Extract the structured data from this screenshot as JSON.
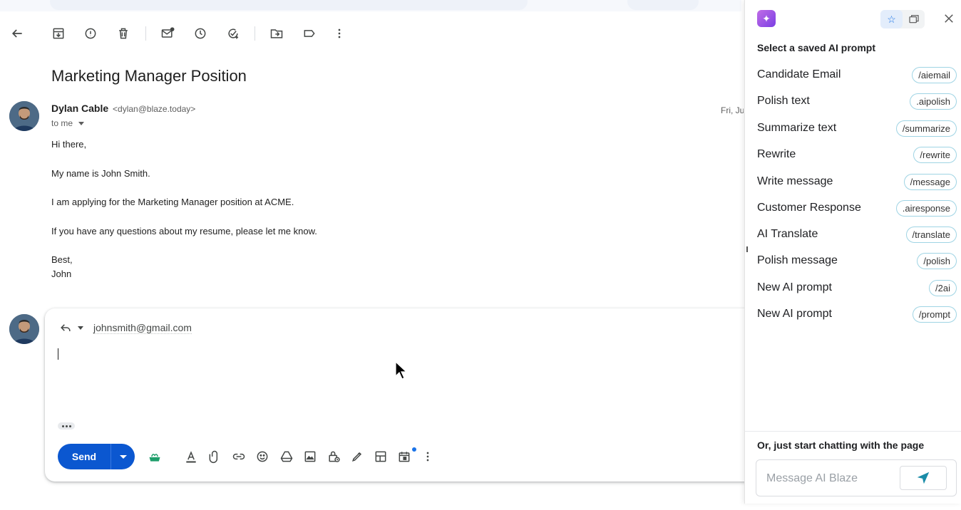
{
  "email": {
    "subject": "Marketing Manager Position",
    "sender_name": "Dylan Cable",
    "sender_email": "<dylan@blaze.today>",
    "to_label": "to me",
    "date": "Fri, Ju",
    "body": {
      "greeting": "Hi there,",
      "line1": "My name is John Smith.",
      "line2": "I am applying for the Marketing Manager position at ACME.",
      "line3": "If you have any questions about my resume, please let me know.",
      "signoff": "Best,",
      "signature": "John"
    }
  },
  "toolbar": {
    "icons": [
      "back-arrow-icon",
      "archive-icon",
      "report-spam-icon",
      "delete-icon",
      "mark-unread-icon",
      "snooze-icon",
      "add-task-icon",
      "move-to-icon",
      "label-icon",
      "more-vert-icon"
    ]
  },
  "reply": {
    "to": "johnsmith@gmail.com",
    "send_label": "Send"
  },
  "panel": {
    "heading": "Select a saved AI prompt",
    "prompts": [
      {
        "name": "Candidate Email",
        "shortcut": "/aiemail"
      },
      {
        "name": "Polish text",
        "shortcut": ".aipolish"
      },
      {
        "name": "Summarize text",
        "shortcut": "/summarize"
      },
      {
        "name": "Rewrite",
        "shortcut": "/rewrite"
      },
      {
        "name": "Write message",
        "shortcut": "/message"
      },
      {
        "name": "Customer Response",
        "shortcut": ".airesponse"
      },
      {
        "name": "AI Translate",
        "shortcut": "/translate"
      },
      {
        "name": "Polish message",
        "shortcut": "/polish"
      },
      {
        "name": "New AI prompt",
        "shortcut": "/2ai"
      },
      {
        "name": "New AI prompt",
        "shortcut": "/prompt"
      }
    ],
    "footer_text": "Or, just start chatting with the page",
    "message_placeholder": "Message AI Blaze"
  },
  "colors": {
    "send_button": "#0b57d0",
    "tag_border": "#9fd4e4",
    "accent": "#1a73e8"
  }
}
